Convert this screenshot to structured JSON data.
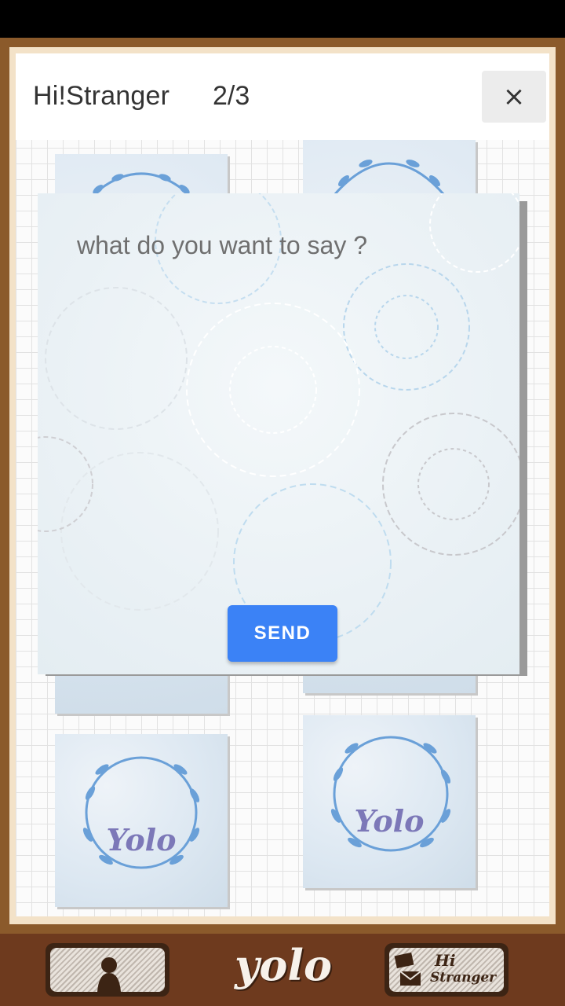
{
  "header": {
    "title": "Hi!Stranger",
    "count": "2/3",
    "close_label": "×"
  },
  "dialog": {
    "placeholder": "what do you want to say ?",
    "send_label": "SEND"
  },
  "cards": [
    {
      "label": ""
    },
    {
      "label": ""
    },
    {
      "label": "Yolo"
    },
    {
      "label": "Yolo"
    }
  ],
  "bottom_nav": {
    "logo": "yolo",
    "profile_icon": "person-silhouette-icon",
    "hi_stranger_icon": "mail-icon",
    "hi_label": "Hi",
    "stranger_label": "Stranger"
  },
  "colors": {
    "frame": "#8b5a2b",
    "send_button": "#3b82f6",
    "bottom_bar": "#6e3a1e"
  }
}
